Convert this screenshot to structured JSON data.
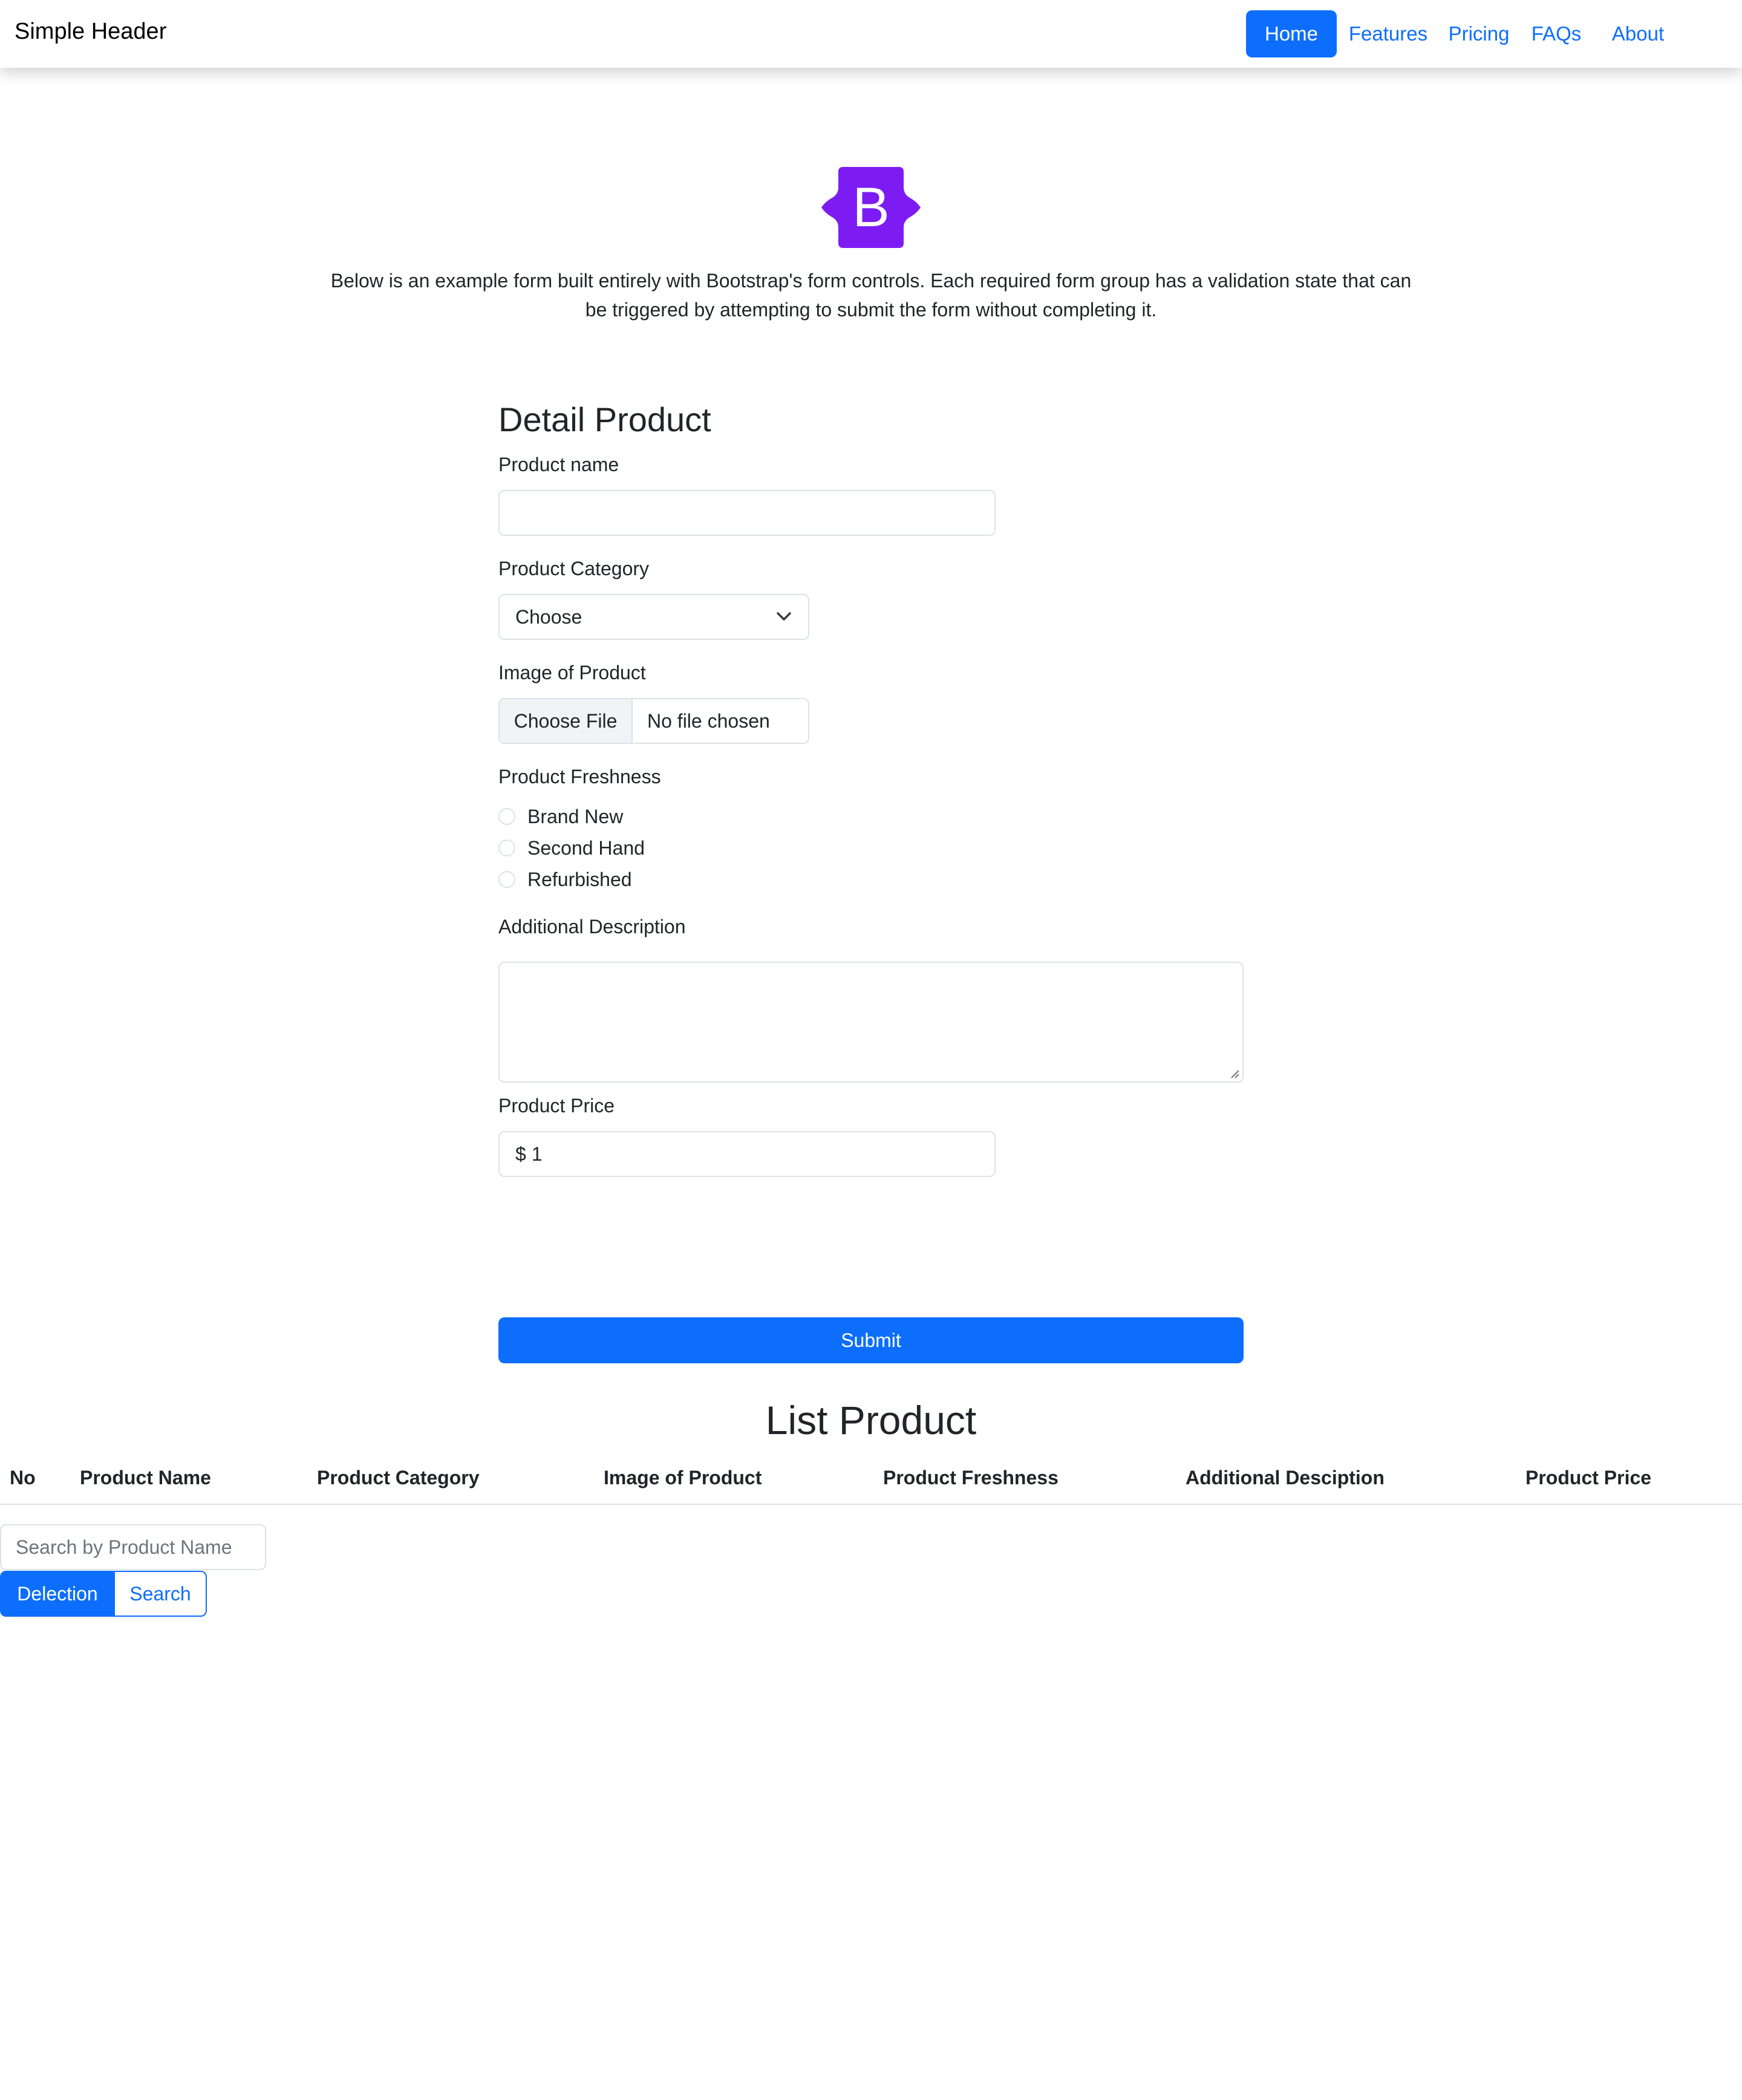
{
  "header": {
    "brand": "Simple Header",
    "nav": [
      {
        "label": "Home",
        "active": true
      },
      {
        "label": "Features",
        "active": false
      },
      {
        "label": "Pricing",
        "active": false
      },
      {
        "label": "FAQs",
        "active": false
      },
      {
        "label": "About",
        "active": false
      }
    ]
  },
  "logo": {
    "icon": "bootstrap-logo-icon",
    "letter": "B",
    "color": "#7c1cf2"
  },
  "intro": {
    "line1": "Below is an example form built entirely with Bootstrap's form controls. Each required form group has a validation state that can",
    "line2": "be triggered by attempting to submit the form without completing it."
  },
  "form": {
    "title": "Detail Product",
    "product_name": {
      "label": "Product name",
      "value": ""
    },
    "category": {
      "label": "Product Category",
      "selected": "Choose"
    },
    "image": {
      "label": "Image of Product",
      "button": "Choose File",
      "status": "No file chosen"
    },
    "freshness": {
      "label": "Product Freshness",
      "options": [
        "Brand New",
        "Second Hand",
        "Refurbished"
      ]
    },
    "description": {
      "label": "Additional Description",
      "value": ""
    },
    "price": {
      "label": "Product Price",
      "value": "$ 1"
    },
    "submit": "Submit"
  },
  "list": {
    "title": "List Product",
    "columns": [
      "No",
      "Product Name",
      "Product Category",
      "Image of Product",
      "Product Freshness",
      "Additional Desciption",
      "Product Price"
    ],
    "search": {
      "placeholder": "Search by Product Name"
    },
    "buttons": {
      "delection": "Delection",
      "search": "Search"
    }
  },
  "colors": {
    "primary": "#0d6efd",
    "border": "#dee2e6",
    "text": "#212529"
  }
}
